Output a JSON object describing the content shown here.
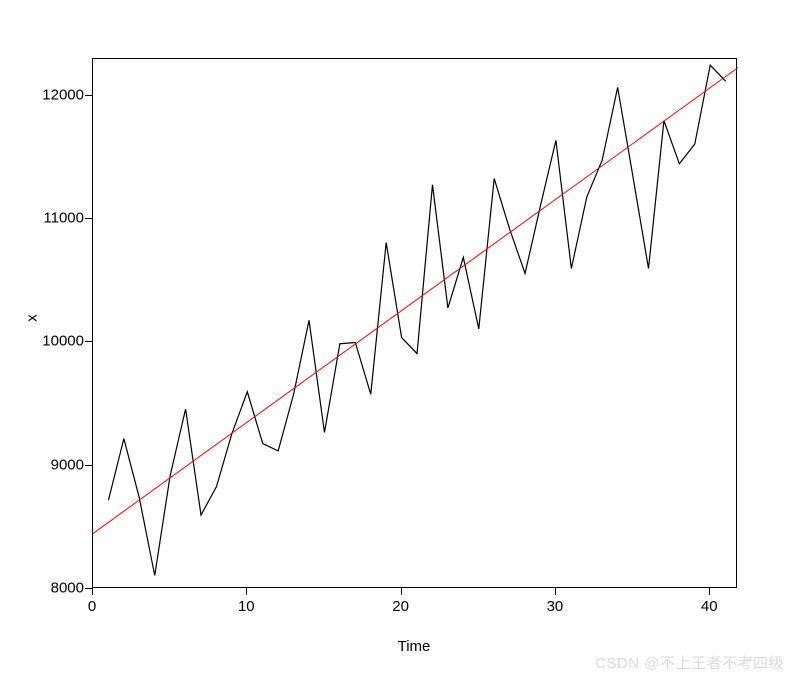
{
  "chart_data": {
    "type": "line",
    "x": [
      1,
      2,
      3,
      4,
      5,
      6,
      7,
      8,
      9,
      10,
      11,
      12,
      13,
      14,
      15,
      16,
      17,
      18,
      19,
      20,
      21,
      22,
      23,
      24,
      25,
      26,
      27,
      28,
      29,
      30,
      31,
      32,
      33,
      34,
      35,
      36,
      37,
      38,
      39,
      40,
      41
    ],
    "series": [
      {
        "name": "x",
        "values": [
          8720,
          9220,
          8740,
          8110,
          8920,
          9460,
          8600,
          8830,
          9260,
          9600,
          9180,
          9120,
          9580,
          10180,
          9270,
          9990,
          10000,
          9580,
          10810,
          10040,
          9910,
          11280,
          10280,
          10690,
          10110,
          11330,
          10920,
          10560,
          11110,
          11640,
          10600,
          11180,
          11480,
          12070,
          11340,
          10600,
          11800,
          11450,
          11610,
          12250,
          12120
        ],
        "color": "#000000"
      },
      {
        "name": "trend",
        "type": "line",
        "x": [
          0,
          41.8
        ],
        "y": [
          8450,
          12230
        ],
        "color": "#ff0000"
      }
    ],
    "xlabel": "Time",
    "ylabel": "x",
    "xlim": [
      0,
      41.8
    ],
    "ylim": [
      8000,
      12300
    ],
    "x_ticks": [
      0,
      10,
      20,
      30,
      40
    ],
    "y_ticks": [
      8000,
      9000,
      10000,
      11000,
      12000
    ],
    "grid": false
  },
  "watermark": "CSDN @不上王者不考四级",
  "axis": {
    "xlabel": "Time",
    "ylabel": "x"
  },
  "y_tick_labels": [
    "8000",
    "9000",
    "10000",
    "11000",
    "12000"
  ],
  "x_tick_labels": [
    "0",
    "10",
    "20",
    "30",
    "40"
  ]
}
